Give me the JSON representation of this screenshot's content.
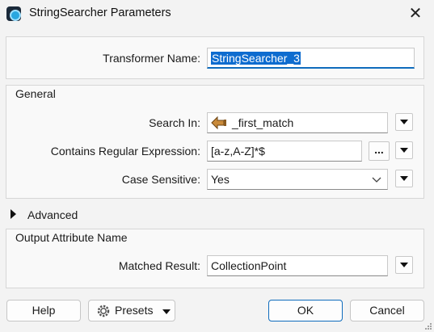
{
  "window": {
    "title": "StringSearcher Parameters",
    "close_glyph": "✕"
  },
  "transformer": {
    "label": "Transformer Name:",
    "value": "StringSearcher_3"
  },
  "general": {
    "title": "General",
    "search_in": {
      "label": "Search In:",
      "value": "_first_match",
      "icon": "attribute-arrow-icon"
    },
    "regex": {
      "label": "Contains Regular Expression:",
      "value": "[a-z,A-Z]*$",
      "ellipsis": "..."
    },
    "case_sensitive": {
      "label": "Case Sensitive:",
      "value": "Yes"
    }
  },
  "advanced": {
    "title": "Advanced"
  },
  "output": {
    "title": "Output Attribute Name",
    "matched_result": {
      "label": "Matched Result:",
      "value": "CollectionPoint"
    }
  },
  "buttons": {
    "help": "Help",
    "presets": "Presets",
    "ok": "OK",
    "cancel": "Cancel"
  },
  "colors": {
    "accent": "#0f6cbd",
    "selection": "#0e6ccf",
    "panel": "#f9f9f9",
    "window": "#f3f3f3"
  }
}
